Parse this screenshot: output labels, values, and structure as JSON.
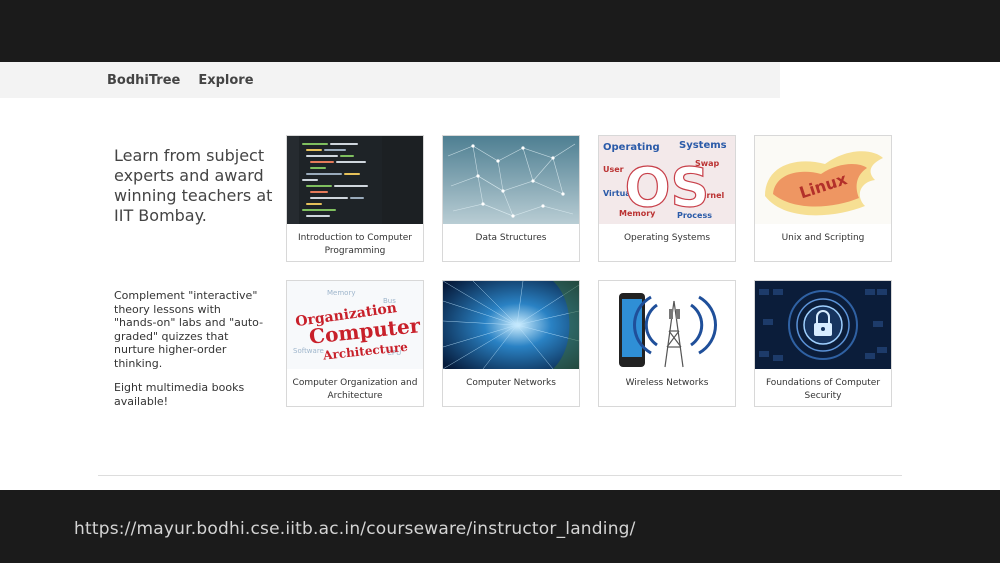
{
  "nav": {
    "brand": "BodhiTree",
    "explore": "Explore"
  },
  "intro": {
    "headline": "Learn from subject experts and award winning teachers at IIT Bombay.",
    "paragraph1": "Complement \"interactive\" theory lessons with \"hands-on\" labs and \"auto-graded\" quizzes that nurture higher-order thinking.",
    "paragraph2": "Eight multimedia books available!"
  },
  "courses": [
    {
      "title": "Introduction to Computer Programming",
      "icon": "code-editor-thumbnail"
    },
    {
      "title": "Data Structures",
      "icon": "network-graph-thumbnail"
    },
    {
      "title": "Operating Systems",
      "icon": "os-wordcloud-thumbnail",
      "art_text": "OS"
    },
    {
      "title": "Unix and Scripting",
      "icon": "linux-wordcloud-thumbnail",
      "art_text": "Linux"
    },
    {
      "title": "Computer Organization and Architecture",
      "icon": "coa-wordcloud-thumbnail",
      "art_lines": [
        "Organization",
        "Computer",
        "Architecture"
      ]
    },
    {
      "title": "Computer Networks",
      "icon": "data-streams-thumbnail"
    },
    {
      "title": "Wireless Networks",
      "icon": "phone-tower-thumbnail"
    },
    {
      "title": "Foundations of Computer Security",
      "icon": "padlock-thumbnail"
    }
  ],
  "footer": {
    "url": "https://mayur.bodhi.cse.iitb.ac.in/courseware/instructor_landing/"
  },
  "colors": {
    "page_bg": "#ffffff",
    "navbar_bg": "#f3f3f3",
    "slide_band": "#1b1b1b",
    "card_border": "#d8d8d8"
  }
}
